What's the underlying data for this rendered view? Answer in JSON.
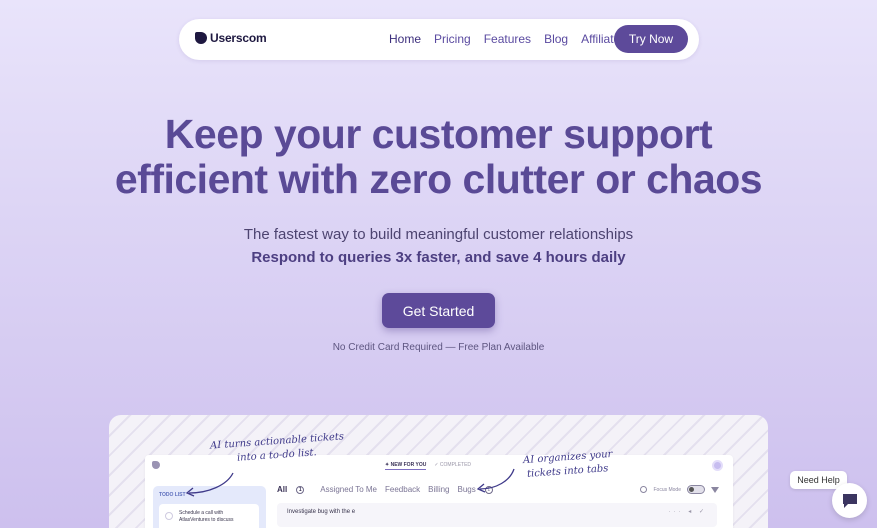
{
  "nav": {
    "brand": "Userscom",
    "links": [
      "Home",
      "Pricing",
      "Features",
      "Blog",
      "Affiliate"
    ],
    "cta": "Try Now"
  },
  "hero": {
    "title_line1": "Keep your customer support",
    "title_line2": "efficient with zero clutter or chaos",
    "subtitle": "The fastest way to build meaningful customer relationships",
    "subtitle_bold": "Respond to queries 3x faster, and save 4 hours daily",
    "cta": "Get Started",
    "fine_print": "No Credit Card Required — Free Plan Available"
  },
  "preview": {
    "annotation_left_1": "AI turns actionable tickets",
    "annotation_left_2": "into a to-do list.",
    "annotation_right_1": "AI organizes your",
    "annotation_right_2": "tickets into tabs",
    "segment_new": "✦ NEW FOR YOU",
    "segment_completed": "✓ COMPLETED",
    "todo_title": "TODO LIST",
    "todo_item": "Schedule a call with AtlasVentures to discuss",
    "tabs": {
      "all": "All",
      "all_count": "1",
      "assigned": "Assigned To Me",
      "feedback": "Feedback",
      "billing": "Billing",
      "bugs": "Bugs",
      "bugs_count": "1"
    },
    "focus_mode": "Focus Mode",
    "ticket_text": "Investigate bug with the e",
    "ticket_icons": "··· ◂ ✓"
  },
  "help": {
    "label": "Need Help",
    "icon": "chat-bubble-icon"
  },
  "colors": {
    "accent": "#5d4a9a",
    "title": "#5a4a96",
    "background_top": "#e9e4fb",
    "background_bottom": "#cdc0ee"
  }
}
